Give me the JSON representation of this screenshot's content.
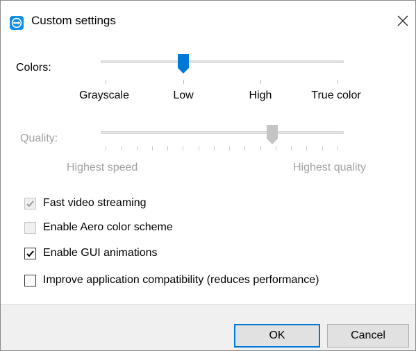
{
  "window": {
    "title": "Custom settings",
    "icon": "teamviewer-icon",
    "close_icon": "close-icon",
    "accent": "#0078d7"
  },
  "colors": {
    "label": "Colors:",
    "steps": [
      "Grayscale",
      "Low",
      "High",
      "True color"
    ],
    "selected": "Low",
    "enabled": true
  },
  "quality": {
    "label": "Quality:",
    "min_label": "Highest speed",
    "max_label": "Highest quality",
    "tick_count": 16,
    "position_fraction": 0.72,
    "enabled": false
  },
  "options": [
    {
      "label": "Fast video streaming",
      "checked": true,
      "enabled": false
    },
    {
      "label": "Enable Aero color scheme",
      "checked": false,
      "enabled": false
    },
    {
      "label": "Enable GUI animations",
      "checked": true,
      "enabled": true
    },
    {
      "label": "Improve application compatibility (reduces performance)",
      "checked": false,
      "enabled": true
    }
  ],
  "buttons": {
    "ok": "OK",
    "cancel": "Cancel"
  }
}
